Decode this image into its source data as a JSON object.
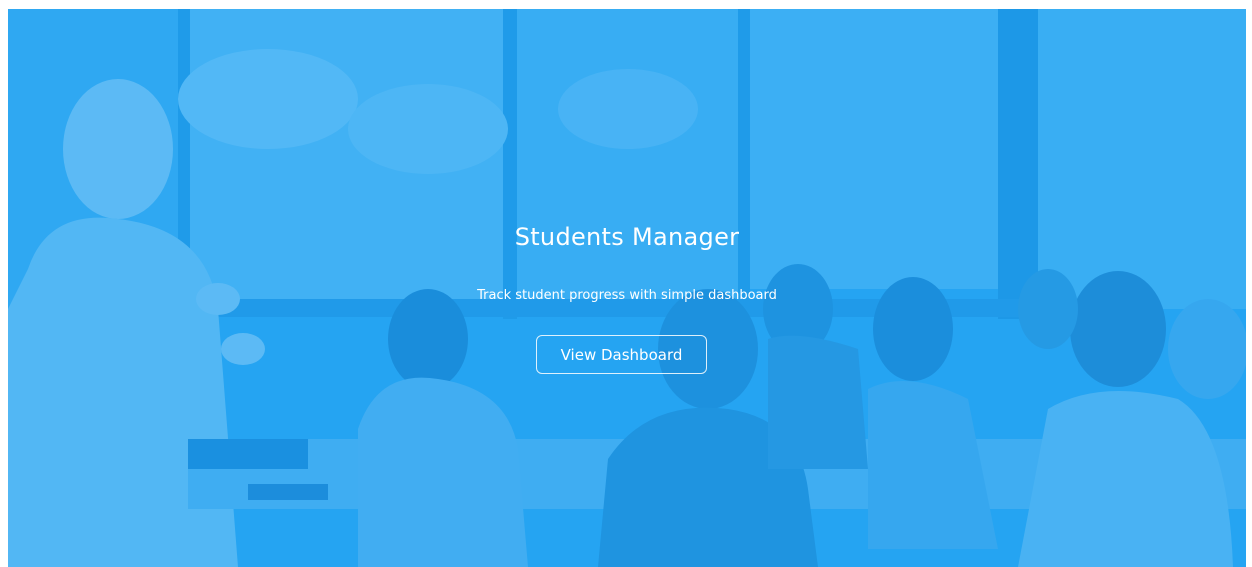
{
  "hero": {
    "title": "Students Manager",
    "subtitle": "Track student progress with simple dashboard",
    "button_label": "View Dashboard"
  },
  "colors": {
    "overlay": "#22a3ee",
    "text": "#ffffff"
  },
  "background_image": "classroom-photo"
}
